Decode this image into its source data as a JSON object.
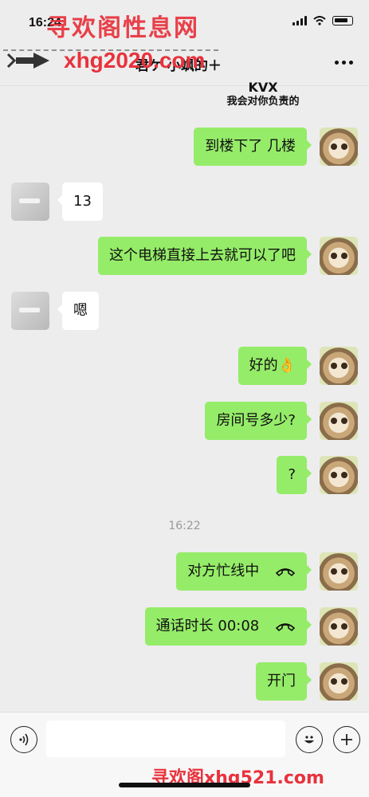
{
  "status_bar": {
    "time": "16:24"
  },
  "watermarks": {
    "top": "寻欢阁性息网",
    "url": "xhg2020.com",
    "bottom": "寻欢阁xhg521.com"
  },
  "header": {
    "title": "君ケ 小飒的＋"
  },
  "previous_image_caption": {
    "mark": "KVX",
    "text": "我会对你负责的"
  },
  "messages": [
    {
      "side": "self",
      "text": "到楼下了 几楼"
    },
    {
      "side": "other",
      "text": "13"
    },
    {
      "side": "self",
      "text": "这个电梯直接上去就可以了吧"
    },
    {
      "side": "other",
      "text": "嗯"
    },
    {
      "side": "self",
      "text": "好的👌"
    },
    {
      "side": "self",
      "text": "房间号多少?"
    },
    {
      "side": "self",
      "text": "?"
    },
    {
      "side": "self",
      "text": "对方忙线中",
      "icon": "phone-hangup-icon"
    },
    {
      "side": "self",
      "text": "通话时长 00:08",
      "icon": "phone-hangup-icon"
    },
    {
      "side": "self",
      "text": "开门"
    }
  ],
  "timestamp": "16:22",
  "input_bar": {
    "placeholder": ""
  },
  "colors": {
    "self_bubble": "#95ec69",
    "other_bubble": "#ffffff",
    "background": "#ededed",
    "watermark": "#e8323c"
  }
}
